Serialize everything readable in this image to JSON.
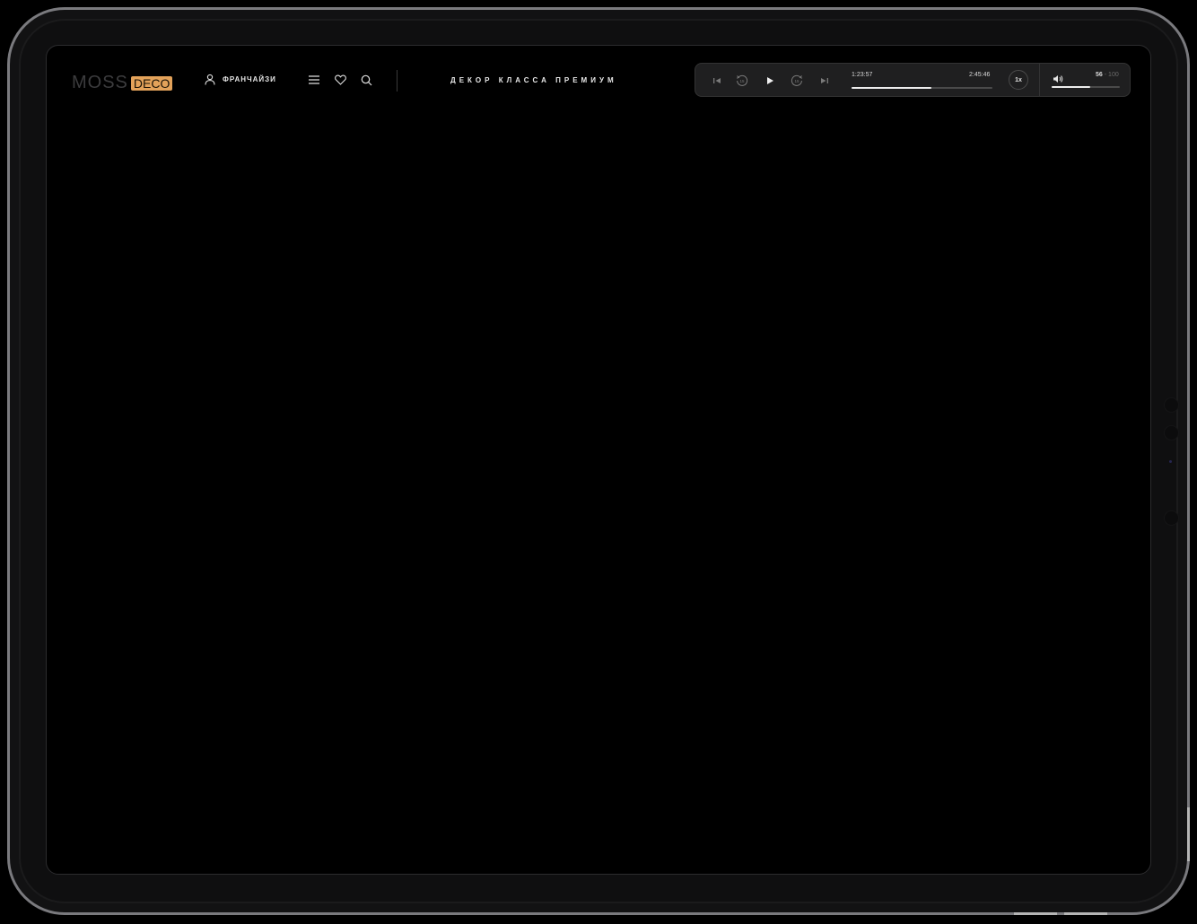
{
  "header": {
    "logo_primary": "MOSS",
    "logo_secondary": "DECO",
    "franchise_label": "ФРАНЧАЙЗИ",
    "tagline": "ДЕКОР КЛАССА ПРЕМИУМ"
  },
  "player": {
    "current_time": "1:23:57",
    "total_time": "2:45:46",
    "progress": 0.57,
    "speed_label": "1x",
    "volume_value": "56",
    "volume_separator": "-",
    "volume_max": "100",
    "volume_level": 0.56
  },
  "colors": {
    "accent": "#e3a25a",
    "background": "#000000",
    "player_bg": "#1f1f20"
  }
}
